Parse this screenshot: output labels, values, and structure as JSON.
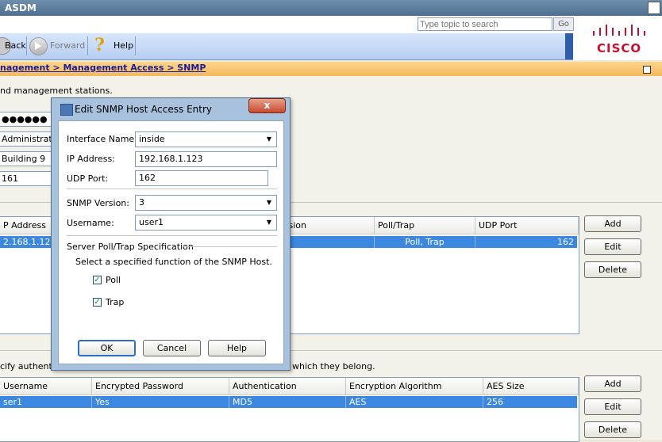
{
  "app": {
    "title": "ASDM"
  },
  "search": {
    "placeholder": "Type topic to search",
    "go_label": "Go"
  },
  "toolbar": {
    "back_label": "Back",
    "forward_label": "Forward",
    "help_label": "Help"
  },
  "brand": {
    "logo_text": "CISCO"
  },
  "breadcrumb": {
    "text": "nagement > Management Access > SNMP"
  },
  "panel": {
    "intro_text": "nd management stations.",
    "password_value": "●●●●●●",
    "contact_value": "Administrator",
    "location_value": "Building 9",
    "port_value": "161",
    "hosts_table": {
      "headers": [
        "P Address",
        "rsion",
        "Poll/Trap",
        "UDP Port"
      ],
      "row": [
        "2.168.1.123",
        "",
        "Poll, Trap",
        "162"
      ]
    },
    "hosts_buttons": {
      "add": "Add",
      "edit": "Edit",
      "delete": "Delete"
    },
    "users_intro": "cify authentic",
    "users_intro_tail": "which they belong.",
    "users_table": {
      "headers": [
        "Username",
        "Encrypted Password",
        "Authentication",
        "Encryption Algorithm",
        "AES Size"
      ],
      "row": [
        "ser1",
        "Yes",
        "MD5",
        "AES",
        "256"
      ]
    },
    "users_buttons": {
      "add": "Add",
      "edit": "Edit",
      "delete": "Delete"
    }
  },
  "dialog": {
    "title": "Edit SNMP Host Access Entry",
    "close_label": "x",
    "interface_label": "Interface Name:",
    "interface_value": "inside",
    "ip_label": "IP Address:",
    "ip_value": "192.168.1.123",
    "udp_label": "UDP Port:",
    "udp_value": "162",
    "version_label": "SNMP Version:",
    "version_value": "3",
    "username_label": "Username:",
    "username_value": "user1",
    "spec_heading": "Server Poll/Trap Specification",
    "spec_desc": "Select a specified function of the SNMP Host.",
    "poll_label": "Poll",
    "poll_checked": true,
    "trap_label": "Trap",
    "trap_checked": true,
    "ok_label": "OK",
    "cancel_label": "Cancel",
    "help_label": "Help"
  },
  "colors": {
    "selection": "#3c88e0",
    "breadcrumb_band": "#f4b95a",
    "titlebar": "#4e6f90",
    "brand": "#c8102e"
  }
}
